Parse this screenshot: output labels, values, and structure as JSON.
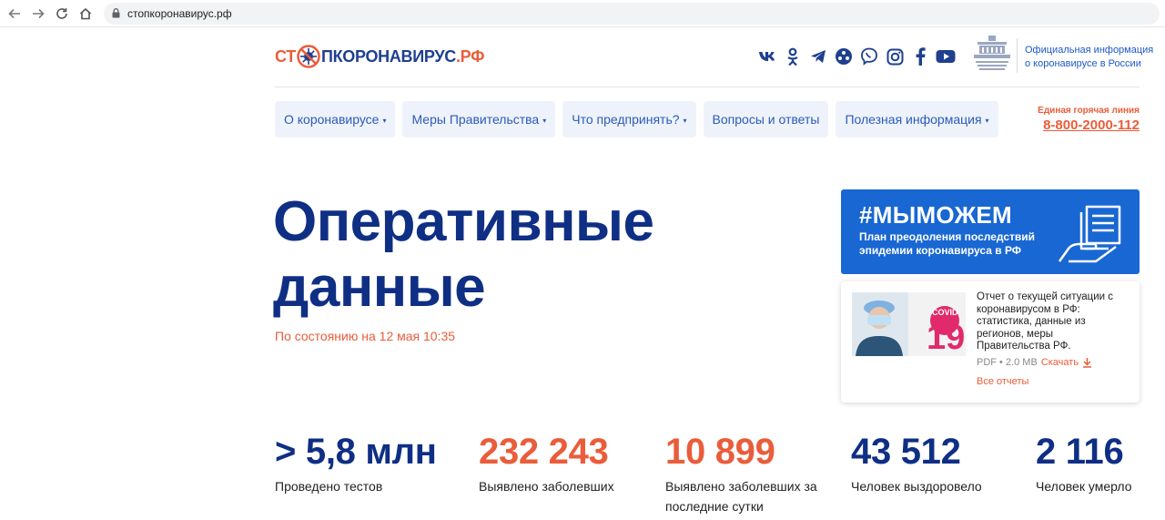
{
  "browser": {
    "url": "стопкоронавирус.рф",
    "back_icon": "arrow-left-icon",
    "forward_icon": "arrow-right-icon",
    "reload_icon": "reload-icon",
    "home_icon": "home-icon"
  },
  "header": {
    "logo": {
      "part1": "СТ",
      "part2": "ПКОРОНАВИРУС",
      "part3": ".РФ"
    },
    "socials": [
      "vk-icon",
      "odnoklassniki-icon",
      "telegram-icon",
      "community-icon",
      "viber-icon",
      "instagram-icon",
      "facebook-icon",
      "youtube-icon"
    ],
    "gov_line1": "Официальная информация",
    "gov_line2": "о коронавирусе в России"
  },
  "menu": {
    "items": [
      {
        "label": "О коронавирусе",
        "dropdown": true
      },
      {
        "label": "Меры Правительства",
        "dropdown": true
      },
      {
        "label": "Что предпринять?",
        "dropdown": true
      },
      {
        "label": "Вопросы и ответы",
        "dropdown": false
      },
      {
        "label": "Полезная информация",
        "dropdown": true
      }
    ],
    "caret": "▾"
  },
  "hotline": {
    "label": "Единая горячая линия",
    "number": "8-800-2000-112"
  },
  "hero": {
    "title_line1": "Оперативные",
    "title_line2": "данные",
    "as_of": "По состоянию на 12 мая 10:35"
  },
  "banner": {
    "tag": "#МЫМОЖЕМ",
    "subtitle": "План преодоления последствий эпидемии коронавируса в РФ"
  },
  "report": {
    "thumb_covid": "COVID",
    "thumb_num": "19",
    "description": "Отчет о текущей ситуации с коронавирусом в РФ: статистика, данные из регионов, меры Правительства РФ.",
    "meta": "PDF • 2.0 MB",
    "download": "Скачать",
    "all_reports": "Все отчеты"
  },
  "stats": [
    {
      "value": "> 5,8 млн",
      "label": "Проведено тестов",
      "color": "blue"
    },
    {
      "value": "232 243",
      "label": "Выявлено заболевших",
      "color": "red"
    },
    {
      "value": "10 899",
      "label": "Выявлено заболевших за последние сутки",
      "color": "red"
    },
    {
      "value": "43 512",
      "label": "Человек выздоровело",
      "color": "blue"
    },
    {
      "value": "2 116",
      "label": "Человек умерло",
      "color": "blue"
    }
  ],
  "colors": {
    "accent_red": "#ea5d3a",
    "dark_blue": "#0f2f85",
    "link_blue": "#2c5ab8",
    "banner_blue": "#1967d2"
  }
}
